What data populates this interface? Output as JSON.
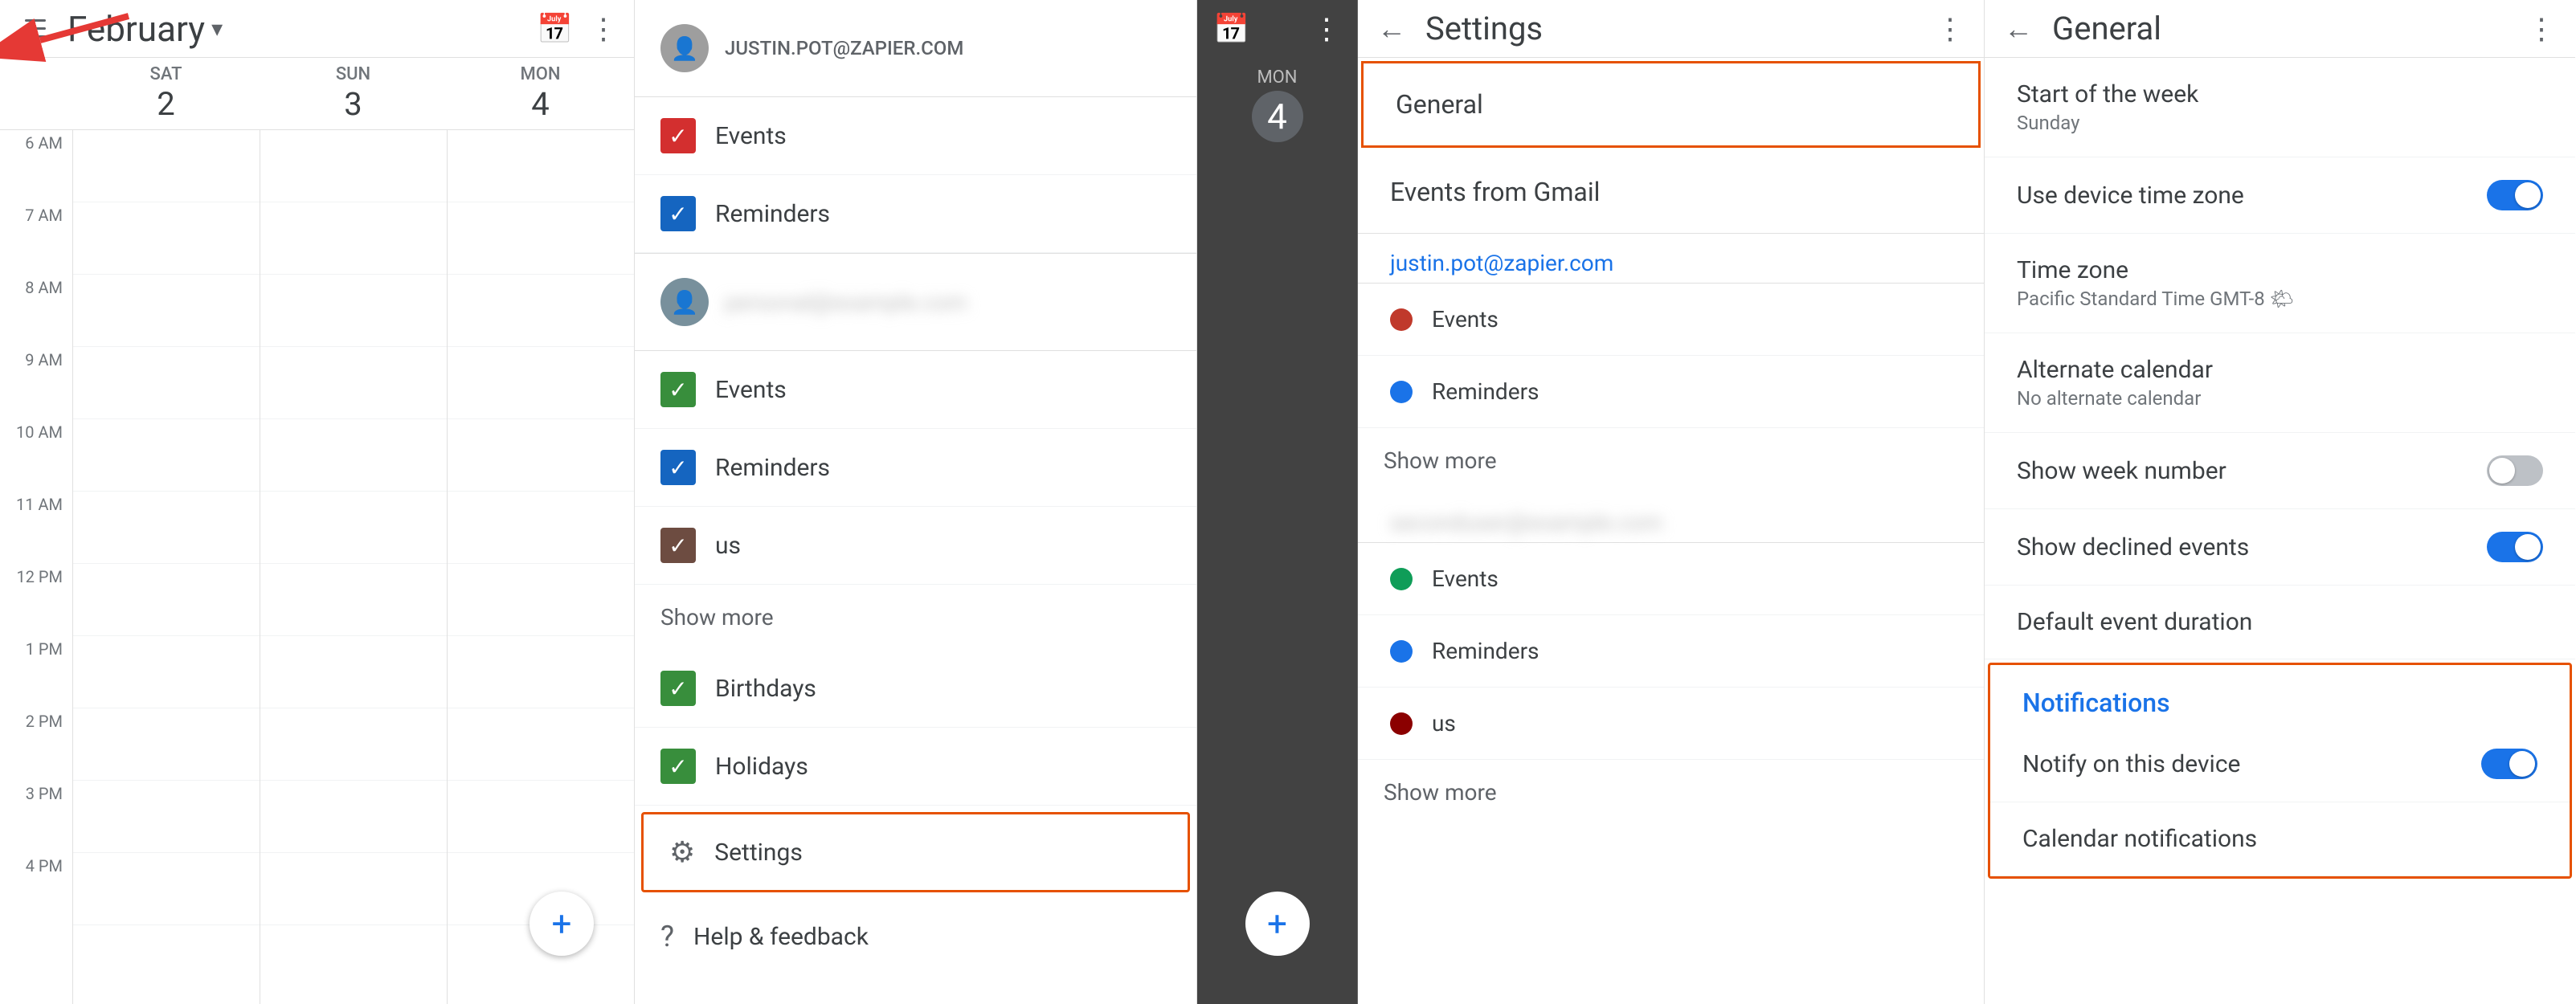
{
  "calendar": {
    "month_title": "February",
    "dropdown_char": "▾",
    "days": [
      {
        "label": "SAT",
        "number": "2"
      },
      {
        "label": "SUN",
        "number": "3"
      },
      {
        "label": "MON",
        "number": "4"
      }
    ],
    "times": [
      "6 AM",
      "7 AM",
      "8 AM",
      "9 AM",
      "10 AM",
      "11 AM",
      "12 PM",
      "1 PM",
      "2 PM",
      "3 PM",
      "4 PM"
    ],
    "fab_label": "+"
  },
  "settings_menu": {
    "user_email": "JUSTIN.POT@ZAPIER.COM",
    "sections": [
      {
        "type": "calendar_entry",
        "label": "Events",
        "color": "red"
      },
      {
        "type": "calendar_entry",
        "label": "Reminders",
        "color": "blue"
      }
    ],
    "second_user": {
      "email_blurred": "personal email blurred"
    },
    "second_calendars": [
      {
        "label": "Events",
        "color": "green"
      },
      {
        "label": "Reminders",
        "color": "blue"
      },
      {
        "label": "us",
        "color": "brown"
      }
    ],
    "show_more": "Show more",
    "birthdays": "Birthdays",
    "holidays": "Holidays",
    "settings_label": "Settings",
    "help_label": "Help & feedback"
  },
  "dark_panel": {
    "day_label": "MON",
    "day_number": "4",
    "fab_label": "+"
  },
  "settings_list": {
    "title": "Settings",
    "items": [
      {
        "label": "General",
        "highlighted": true
      },
      {
        "label": "Events from Gmail",
        "highlighted": false
      }
    ],
    "user_email": "justin.pot@zapier.com",
    "user_calendars": [
      {
        "label": "Events",
        "color": "red"
      },
      {
        "label": "Reminders",
        "color": "blue"
      }
    ],
    "show_more": "Show more",
    "second_user_blurred": "blurred email",
    "second_calendars": [
      {
        "label": "Events",
        "color": "green"
      },
      {
        "label": "Reminders",
        "color": "blue"
      },
      {
        "label": "us",
        "color": "dark-red"
      }
    ],
    "show_more2": "Show more"
  },
  "general_settings": {
    "title": "General",
    "back_label": "←",
    "more_label": "⋮",
    "rows": [
      {
        "label": "Start of the week",
        "sublabel": "Sunday",
        "type": "text_only"
      },
      {
        "label": "Use device time zone",
        "sublabel": null,
        "type": "toggle",
        "toggle_state": "on"
      },
      {
        "label": "Time zone",
        "sublabel": "Pacific Standard Time  GMT-8 🌤",
        "type": "text_only"
      },
      {
        "label": "Alternate calendar",
        "sublabel": "No alternate calendar",
        "type": "text_only"
      },
      {
        "label": "Show week number",
        "sublabel": null,
        "type": "toggle",
        "toggle_state": "off"
      },
      {
        "label": "Show declined events",
        "sublabel": null,
        "type": "toggle",
        "toggle_state": "on"
      },
      {
        "label": "Default event duration",
        "sublabel": null,
        "type": "text_only"
      }
    ],
    "notifications_section_label": "Notifications",
    "notification_rows": [
      {
        "label": "Notify on this device",
        "sublabel": null,
        "type": "toggle",
        "toggle_state": "on"
      },
      {
        "label": "Calendar notifications",
        "sublabel": null,
        "type": "text_only"
      }
    ]
  }
}
